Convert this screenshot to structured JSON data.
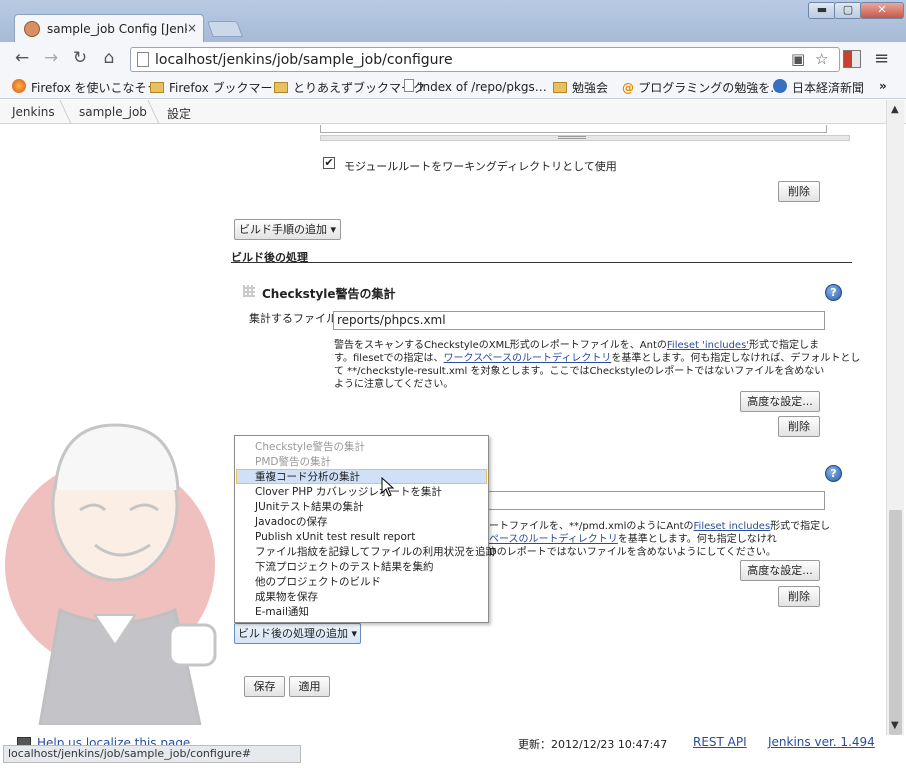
{
  "browser": {
    "tab_title": "sample_job Config [Jenkins]",
    "tab_close": "×",
    "url": "localhost/jenkins/job/sample_job/configure",
    "window_buttons": {
      "minimize": "▬",
      "maximize": "▢",
      "close": "✕"
    },
    "bookmarks": [
      {
        "label": "Firefox を使いこなそう",
        "icon": "firefox-icon"
      },
      {
        "label": "Firefox ブックマーク",
        "icon": "folder-icon"
      },
      {
        "label": "とりあえずブックマーク",
        "icon": "folder-icon"
      },
      {
        "label": "Index of /repo/pkgs…",
        "icon": "page-icon"
      },
      {
        "label": "勉強会",
        "icon": "folder-icon"
      },
      {
        "label": "プログラミングの勉強を…",
        "icon": "at-icon"
      },
      {
        "label": "日本経済新聞",
        "icon": "nikkei-icon"
      }
    ],
    "bookmarks_more": "»",
    "status_url": "localhost/jenkins/job/sample_job/configure#"
  },
  "breadcrumb": [
    "Jenkins",
    "sample_job",
    "設定"
  ],
  "form": {
    "use_module_root_label": "モジュールルートをワーキングディレクトリとして使用",
    "use_module_root_checked": true,
    "delete_label": "削除",
    "add_build_step_label": "ビルド手順の追加 ▾",
    "post_build_section_title": "ビルド後の処理",
    "checkstyle": {
      "title": "Checkstyle警告の集計",
      "files_label": "集計するファイル",
      "files_value": "reports/phpcs.xml",
      "desc_1": "警告をスキャンするCheckstyleのXML形式のレポートファイルを、Antの",
      "desc_link_1": "Fileset 'includes'",
      "desc_2": "形式で指定しま",
      "desc_3": "す。filesetでの指定は、",
      "desc_link_2": "ワークスペースのルートディレクトリ",
      "desc_4": "を基準とします。何も指定しなければ、デフォルトとし",
      "desc_5": "て **/checkstyle-result.xml を対象とします。ここではCheckstyleのレポートではないファイルを含めない",
      "desc_6": "ように注意してください。",
      "advanced_label": "高度な設定...",
      "delete_label": "削除"
    },
    "pmd": {
      "desc_1": "ートファイルを、**/pmd.xmlのようにAntの",
      "desc_link_1": "Fileset includes",
      "desc_2": "形式で指定し",
      "desc_link_2": "ペースのルートディレクトリ",
      "desc_3": "を基準とします。何も指定しなけれ",
      "desc_4": "Dのレポートではないファイルを含めないようにしてください。",
      "advanced_label": "高度な設定...",
      "delete_label": "削除"
    },
    "add_post_build_label": "ビルド後の処理の追加 ▾",
    "save_label": "保存",
    "apply_label": "適用"
  },
  "post_build_menu": [
    {
      "label": "Checkstyle警告の集計",
      "state": "disabled"
    },
    {
      "label": "PMD警告の集計",
      "state": "disabled"
    },
    {
      "label": "重複コード分析の集計",
      "state": "highlighted"
    },
    {
      "label": "Clover PHP カバレッジレポートを集計",
      "state": "normal"
    },
    {
      "label": "JUnitテスト結果の集計",
      "state": "normal"
    },
    {
      "label": "Javadocの保存",
      "state": "normal"
    },
    {
      "label": "Publish xUnit test result report",
      "state": "normal"
    },
    {
      "label": "ファイル指紋を記録してファイルの利用状況を追跡",
      "state": "normal"
    },
    {
      "label": "下流プロジェクトのテスト結果を集約",
      "state": "normal"
    },
    {
      "label": "他のプロジェクトのビルド",
      "state": "normal"
    },
    {
      "label": "成果物を保存",
      "state": "normal"
    },
    {
      "label": "E-mail通知",
      "state": "normal"
    }
  ],
  "footer": {
    "localize_link": "Help us localize this page",
    "updated": "更新：2012/12/23 10:47:47",
    "rest_api": "REST API",
    "version": "Jenkins ver. 1.494"
  },
  "colors": {
    "link": "#2a4c9a",
    "menu_highlight": "#cfe0f7",
    "menu_highlight_border": "#e8c45a",
    "titlebar": "#b9cbe3"
  }
}
